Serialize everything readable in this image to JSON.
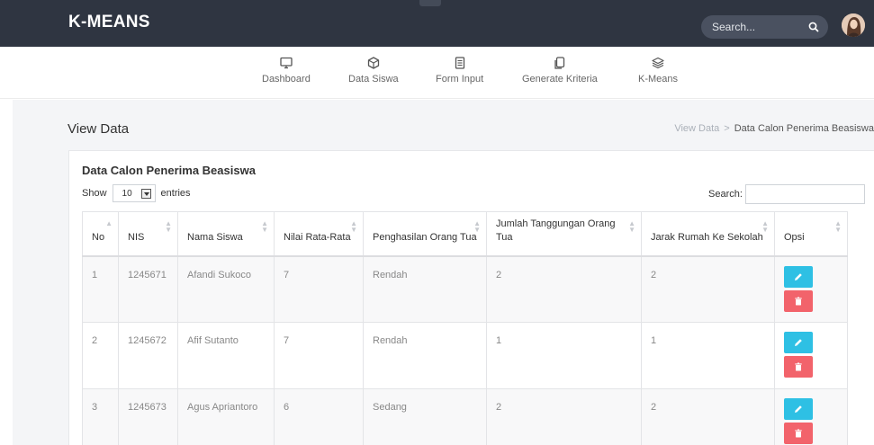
{
  "app": {
    "brand": "K-MEANS"
  },
  "header": {
    "search_placeholder": "Search..."
  },
  "nav": [
    {
      "label": "Dashboard",
      "icon": "monitor-icon"
    },
    {
      "label": "Data Siswa",
      "icon": "cube-icon"
    },
    {
      "label": "Form Input",
      "icon": "document-icon"
    },
    {
      "label": "Generate Kriteria",
      "icon": "copy-icon"
    },
    {
      "label": "K-Means",
      "icon": "layers-icon"
    }
  ],
  "page": {
    "title": "View Data",
    "breadcrumb": [
      "View Data",
      "Data Calon Penerima Beasiswa"
    ]
  },
  "card": {
    "title": "Data Calon Penerima Beasiswa"
  },
  "table_controls": {
    "show_label": "Show",
    "entries_value": "10",
    "entries_label": "entries",
    "search_label": "Search:"
  },
  "table": {
    "columns": [
      "No",
      "NIS",
      "Nama Siswa",
      "Nilai Rata-Rata",
      "Penghasilan Orang Tua",
      "Jumlah Tanggungan Orang Tua",
      "Jarak Rumah Ke Sekolah",
      "Opsi"
    ],
    "rows": [
      [
        "1",
        "1245671",
        "Afandi Sukoco",
        "7",
        "Rendah",
        "2",
        "2"
      ],
      [
        "2",
        "1245672",
        "Afif Sutanto",
        "7",
        "Rendah",
        "1",
        "1"
      ],
      [
        "3",
        "1245673",
        "Agus Apriantoro",
        "6",
        "Sedang",
        "2",
        "2"
      ]
    ]
  },
  "colors": {
    "topbar": "#2f3541",
    "edit": "#2ec0e4",
    "delete": "#f2636b"
  }
}
